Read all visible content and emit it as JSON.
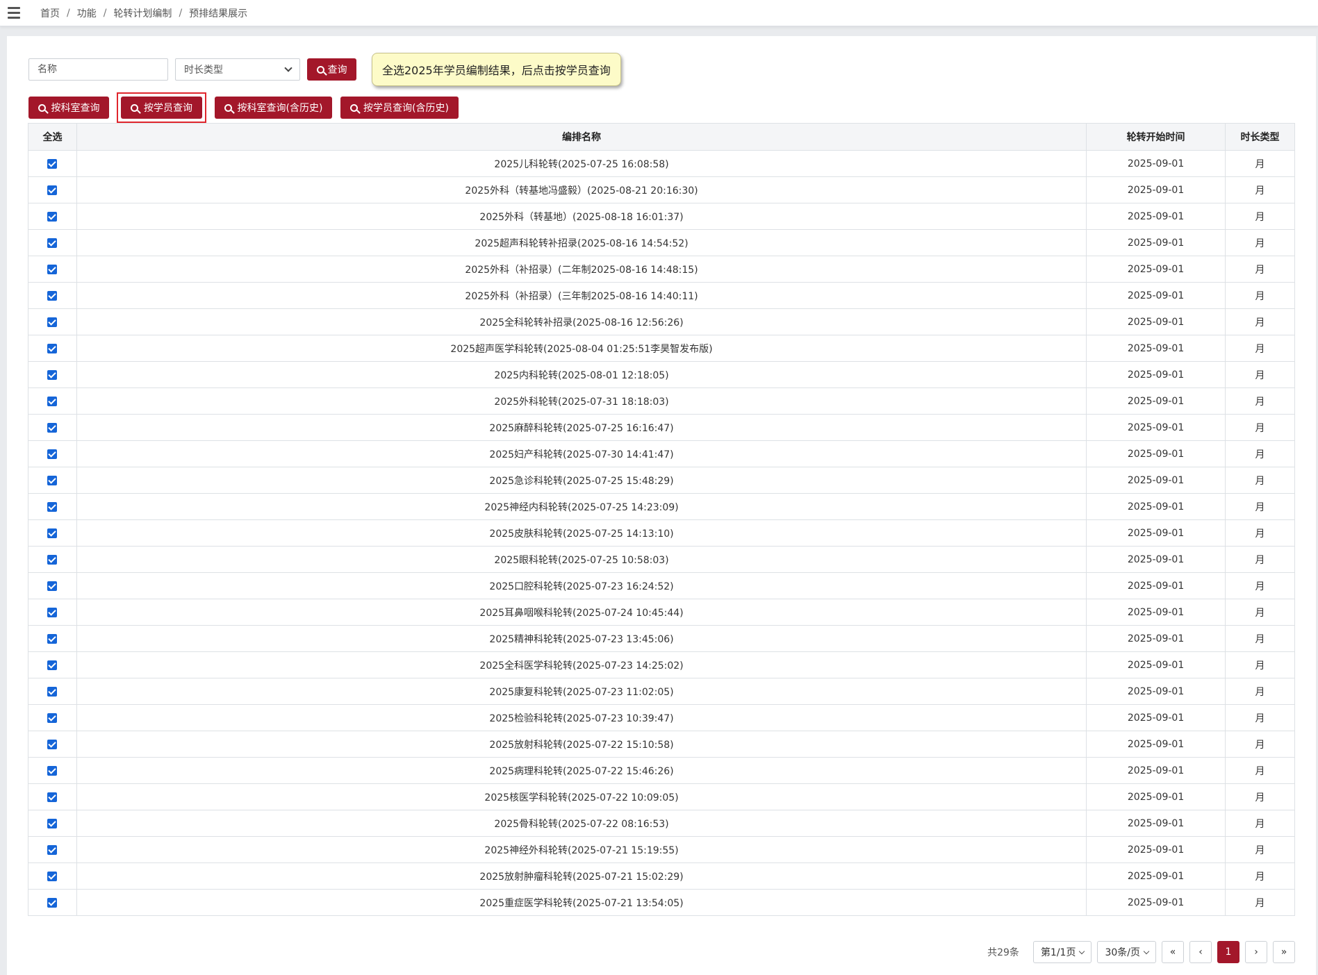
{
  "breadcrumb": [
    "首页",
    "功能",
    "轮转计划编制",
    "预排结果展示"
  ],
  "search": {
    "name_placeholder": "名称",
    "duration_type_placeholder": "时长类型",
    "query_label": "查询"
  },
  "tooltip": "全选2025年学员编制结果，后点击按学员查询",
  "actions": {
    "by_dept": "按科室查询",
    "by_student": "按学员查询",
    "by_dept_history": "按科室查询(含历史)",
    "by_student_history": "按学员查询(含历史)"
  },
  "table": {
    "headers": [
      "全选",
      "编排名称",
      "轮转开始时间",
      "时长类型"
    ],
    "rows": [
      {
        "name": "2025儿科轮转(2025-07-25 16:08:58)",
        "start": "2025-09-01",
        "type": "月",
        "checked": true
      },
      {
        "name": "2025外科（转基地冯盛毅）(2025-08-21 20:16:30)",
        "start": "2025-09-01",
        "type": "月",
        "checked": true
      },
      {
        "name": "2025外科（转基地）(2025-08-18 16:01:37)",
        "start": "2025-09-01",
        "type": "月",
        "checked": true
      },
      {
        "name": "2025超声科轮转补招录(2025-08-16 14:54:52)",
        "start": "2025-09-01",
        "type": "月",
        "checked": true
      },
      {
        "name": "2025外科（补招录）(二年制2025-08-16 14:48:15)",
        "start": "2025-09-01",
        "type": "月",
        "checked": true
      },
      {
        "name": "2025外科（补招录）(三年制2025-08-16 14:40:11)",
        "start": "2025-09-01",
        "type": "月",
        "checked": true
      },
      {
        "name": "2025全科轮转补招录(2025-08-16 12:56:26)",
        "start": "2025-09-01",
        "type": "月",
        "checked": true
      },
      {
        "name": "2025超声医学科轮转(2025-08-04 01:25:51李昊智发布版)",
        "start": "2025-09-01",
        "type": "月",
        "checked": true
      },
      {
        "name": "2025内科轮转(2025-08-01 12:18:05)",
        "start": "2025-09-01",
        "type": "月",
        "checked": true
      },
      {
        "name": "2025外科轮转(2025-07-31 18:18:03)",
        "start": "2025-09-01",
        "type": "月",
        "checked": true
      },
      {
        "name": "2025麻醉科轮转(2025-07-25 16:16:47)",
        "start": "2025-09-01",
        "type": "月",
        "checked": true
      },
      {
        "name": "2025妇产科轮转(2025-07-30 14:41:47)",
        "start": "2025-09-01",
        "type": "月",
        "checked": true
      },
      {
        "name": "2025急诊科轮转(2025-07-25 15:48:29)",
        "start": "2025-09-01",
        "type": "月",
        "checked": true
      },
      {
        "name": "2025神经内科轮转(2025-07-25 14:23:09)",
        "start": "2025-09-01",
        "type": "月",
        "checked": true
      },
      {
        "name": "2025皮肤科轮转(2025-07-25 14:13:10)",
        "start": "2025-09-01",
        "type": "月",
        "checked": true
      },
      {
        "name": "2025眼科轮转(2025-07-25 10:58:03)",
        "start": "2025-09-01",
        "type": "月",
        "checked": true
      },
      {
        "name": "2025口腔科轮转(2025-07-23 16:24:52)",
        "start": "2025-09-01",
        "type": "月",
        "checked": true
      },
      {
        "name": "2025耳鼻咽喉科轮转(2025-07-24 10:45:44)",
        "start": "2025-09-01",
        "type": "月",
        "checked": true
      },
      {
        "name": "2025精神科轮转(2025-07-23 13:45:06)",
        "start": "2025-09-01",
        "type": "月",
        "checked": true
      },
      {
        "name": "2025全科医学科轮转(2025-07-23 14:25:02)",
        "start": "2025-09-01",
        "type": "月",
        "checked": true
      },
      {
        "name": "2025康复科轮转(2025-07-23 11:02:05)",
        "start": "2025-09-01",
        "type": "月",
        "checked": true
      },
      {
        "name": "2025检验科轮转(2025-07-23 10:39:47)",
        "start": "2025-09-01",
        "type": "月",
        "checked": true
      },
      {
        "name": "2025放射科轮转(2025-07-22 15:10:58)",
        "start": "2025-09-01",
        "type": "月",
        "checked": true
      },
      {
        "name": "2025病理科轮转(2025-07-22 15:46:26)",
        "start": "2025-09-01",
        "type": "月",
        "checked": true
      },
      {
        "name": "2025核医学科轮转(2025-07-22 10:09:05)",
        "start": "2025-09-01",
        "type": "月",
        "checked": true
      },
      {
        "name": "2025骨科轮转(2025-07-22 08:16:53)",
        "start": "2025-09-01",
        "type": "月",
        "checked": true
      },
      {
        "name": "2025神经外科轮转(2025-07-21 15:19:55)",
        "start": "2025-09-01",
        "type": "月",
        "checked": true
      },
      {
        "name": "2025放射肿瘤科轮转(2025-07-21 15:02:29)",
        "start": "2025-09-01",
        "type": "月",
        "checked": true
      },
      {
        "name": "2025重症医学科轮转(2025-07-21 13:54:05)",
        "start": "2025-09-01",
        "type": "月",
        "checked": true
      }
    ]
  },
  "pager": {
    "total": "共29条",
    "page_select": "第1/1页",
    "page_size": "30条/页",
    "first": "«",
    "prev": "‹",
    "current": "1",
    "next": "›",
    "last": "»"
  },
  "colors": {
    "accent": "#a3172a",
    "checkbox": "#1565d8",
    "tooltip_bg": "#fdfbc8",
    "highlight_border": "#e0262d"
  }
}
